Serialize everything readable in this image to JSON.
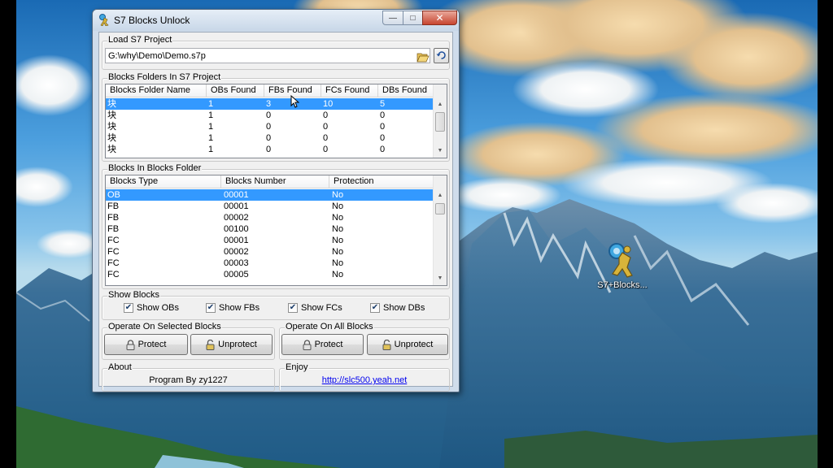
{
  "window": {
    "title": "S7 Blocks Unlock"
  },
  "load_project": {
    "group_title": "Load S7 Project",
    "path_value": "G:\\why\\Demo\\Demo.s7p",
    "open_icon": "folder-open-icon",
    "reload_icon": "reload-icon"
  },
  "folders": {
    "group_title": "Blocks Folders In S7 Project",
    "columns": [
      "Blocks Folder Name",
      "OBs Found",
      "FBs Found",
      "FCs Found",
      "DBs Found"
    ],
    "rows": [
      [
        "块",
        "1",
        "3",
        "10",
        "5"
      ],
      [
        "块",
        "1",
        "0",
        "0",
        "0"
      ],
      [
        "块",
        "1",
        "0",
        "0",
        "0"
      ],
      [
        "块",
        "1",
        "0",
        "0",
        "0"
      ],
      [
        "块",
        "1",
        "0",
        "0",
        "0"
      ]
    ],
    "selected_row": 0
  },
  "blocks": {
    "group_title": "Blocks In Blocks Folder",
    "columns": [
      "Blocks Type",
      "Blocks Number",
      "Protection"
    ],
    "rows": [
      [
        "OB",
        "00001",
        "No"
      ],
      [
        "FB",
        "00001",
        "No"
      ],
      [
        "FB",
        "00002",
        "No"
      ],
      [
        "FB",
        "00100",
        "No"
      ],
      [
        "FC",
        "00001",
        "No"
      ],
      [
        "FC",
        "00002",
        "No"
      ],
      [
        "FC",
        "00003",
        "No"
      ],
      [
        "FC",
        "00005",
        "No"
      ]
    ],
    "selected_row": 0
  },
  "show_blocks": {
    "group_title": "Show Blocks",
    "options": [
      {
        "label": "Show OBs",
        "checked": true
      },
      {
        "label": "Show FBs",
        "checked": true
      },
      {
        "label": "Show FCs",
        "checked": true
      },
      {
        "label": "Show DBs",
        "checked": true
      }
    ]
  },
  "operate_selected": {
    "group_title": "Operate On Selected Blocks",
    "protect_label": "Protect",
    "unprotect_label": "Unprotect"
  },
  "operate_all": {
    "group_title": "Operate On All Blocks",
    "protect_label": "Protect",
    "unprotect_label": "Unprotect"
  },
  "about": {
    "group_title": "About",
    "text": "Program By zy1227"
  },
  "enjoy": {
    "group_title": "Enjoy",
    "link": "http://slc500.yeah.net"
  },
  "desktop_icon": {
    "label": "S7+Blocks...",
    "icon": "s7-unlock-app-icon"
  },
  "colors": {
    "selection": "#3399ff",
    "window_frame": "#cfdceb",
    "client_bg": "#f0f0f0"
  }
}
